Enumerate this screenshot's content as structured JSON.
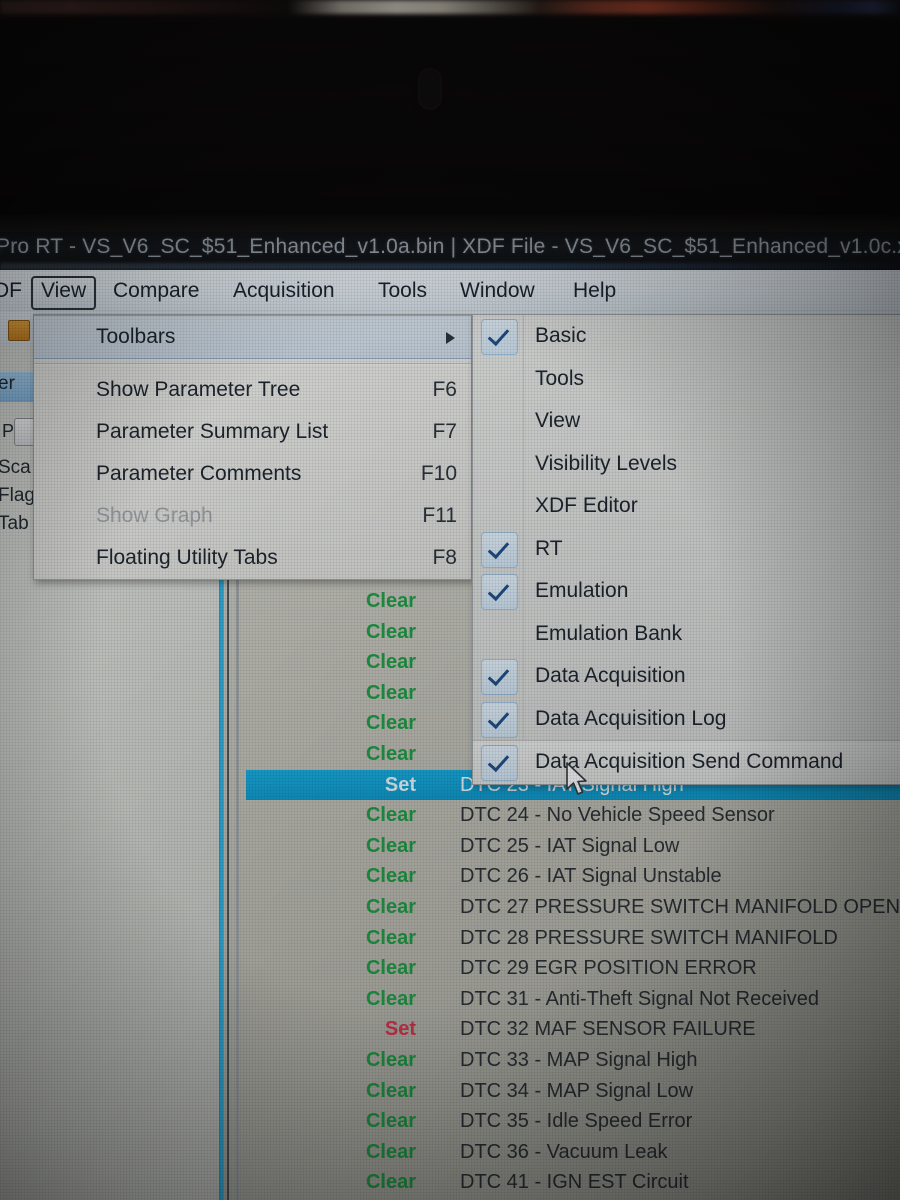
{
  "window": {
    "title": "Pro RT - VS_V6_SC_$51_Enhanced_v1.0a.bin | XDF File - VS_V6_SC_$51_Enhanced_v1.0c.x"
  },
  "menubar": {
    "items": [
      {
        "label": "DF",
        "active": false
      },
      {
        "label": "View",
        "active": true
      },
      {
        "label": "Compare",
        "active": false
      },
      {
        "label": "Acquisition",
        "active": false
      },
      {
        "label": "Tools",
        "active": false
      },
      {
        "label": "Window",
        "active": false
      },
      {
        "label": "Help",
        "active": false
      }
    ]
  },
  "left_panel": {
    "labels": [
      "er",
      "Sca",
      "Flag",
      "Tab"
    ],
    "button_label": "P"
  },
  "view_menu": {
    "items": [
      {
        "label": "Toolbars",
        "accel": "",
        "highlighted": true,
        "submenu": true,
        "disabled": false
      },
      {
        "label": "Show Parameter Tree",
        "accel": "F6",
        "highlighted": false,
        "submenu": false,
        "disabled": false
      },
      {
        "label": "Parameter Summary List",
        "accel": "F7",
        "highlighted": false,
        "submenu": false,
        "disabled": false
      },
      {
        "label": "Parameter Comments",
        "accel": "F10",
        "highlighted": false,
        "submenu": false,
        "disabled": false
      },
      {
        "label": "Show Graph",
        "accel": "F11",
        "highlighted": false,
        "submenu": false,
        "disabled": true
      },
      {
        "label": "Floating Utility Tabs",
        "accel": "F8",
        "highlighted": false,
        "submenu": false,
        "disabled": false
      }
    ]
  },
  "toolbars_submenu": {
    "items": [
      {
        "label": "Basic",
        "checked": true,
        "highlighted": false
      },
      {
        "label": "Tools",
        "checked": false,
        "highlighted": false
      },
      {
        "label": "View",
        "checked": false,
        "highlighted": false
      },
      {
        "label": "Visibility Levels",
        "checked": false,
        "highlighted": false
      },
      {
        "label": "XDF Editor",
        "checked": false,
        "highlighted": false
      },
      {
        "label": "RT",
        "checked": true,
        "highlighted": false
      },
      {
        "label": "Emulation",
        "checked": true,
        "highlighted": false
      },
      {
        "label": "Emulation Bank",
        "checked": false,
        "highlighted": false
      },
      {
        "label": "Data Acquisition",
        "checked": true,
        "highlighted": false
      },
      {
        "label": "Data Acquisition  Log",
        "checked": true,
        "highlighted": false
      },
      {
        "label": "Data Acquisition Send Command",
        "checked": true,
        "highlighted": true
      }
    ]
  },
  "dtc_list": {
    "rows": [
      {
        "state": "Clear",
        "description": "",
        "selected": false,
        "obscured": true
      },
      {
        "state": "Clear",
        "description": "",
        "selected": false,
        "obscured": true
      },
      {
        "state": "Clear",
        "description": "",
        "selected": false,
        "obscured": true
      },
      {
        "state": "Clear",
        "description": "",
        "selected": false,
        "obscured": true
      },
      {
        "state": "Clear",
        "description": "",
        "selected": false,
        "obscured": true
      },
      {
        "state": "Clear",
        "description": "",
        "selected": false,
        "obscured": true
      },
      {
        "state": "Set",
        "description": "DTC 23 - IAT Signal High",
        "selected": true,
        "obscured": false
      },
      {
        "state": "Clear",
        "description": "DTC 24 - No Vehicle Speed Sensor",
        "selected": false,
        "obscured": false
      },
      {
        "state": "Clear",
        "description": "DTC 25 - IAT Signal Low",
        "selected": false,
        "obscured": false
      },
      {
        "state": "Clear",
        "description": "DTC 26 - IAT Signal Unstable",
        "selected": false,
        "obscured": false
      },
      {
        "state": "Clear",
        "description": "DTC 27  PRESSURE SWITCH MANIFOLD OPEN",
        "selected": false,
        "obscured": false
      },
      {
        "state": "Clear",
        "description": "DTC 28  PRESSURE SWITCH MANIFOLD",
        "selected": false,
        "obscured": false
      },
      {
        "state": "Clear",
        "description": "DTC 29  EGR POSITION ERROR",
        "selected": false,
        "obscured": false
      },
      {
        "state": "Clear",
        "description": "DTC 31 - Anti-Theft Signal Not Received",
        "selected": false,
        "obscured": false
      },
      {
        "state": "Set",
        "description": "DTC 32  MAF SENSOR FAILURE",
        "selected": false,
        "obscured": false
      },
      {
        "state": "Clear",
        "description": "DTC 33 - MAP Signal High",
        "selected": false,
        "obscured": false
      },
      {
        "state": "Clear",
        "description": "DTC 34 - MAP Signal Low",
        "selected": false,
        "obscured": false
      },
      {
        "state": "Clear",
        "description": "DTC 35 - Idle Speed Error",
        "selected": false,
        "obscured": false
      },
      {
        "state": "Clear",
        "description": "DTC 36 - Vacuum Leak",
        "selected": false,
        "obscured": false
      },
      {
        "state": "Clear",
        "description": "DTC 41 - IGN EST Circuit",
        "selected": false,
        "obscured": false
      }
    ]
  },
  "colors": {
    "selection": "#17a6d8",
    "state_clear": "#1f9a45",
    "state_set": "#d2354f",
    "menu_bg": "#dcdedd",
    "check_accent": "#1f4e87"
  }
}
